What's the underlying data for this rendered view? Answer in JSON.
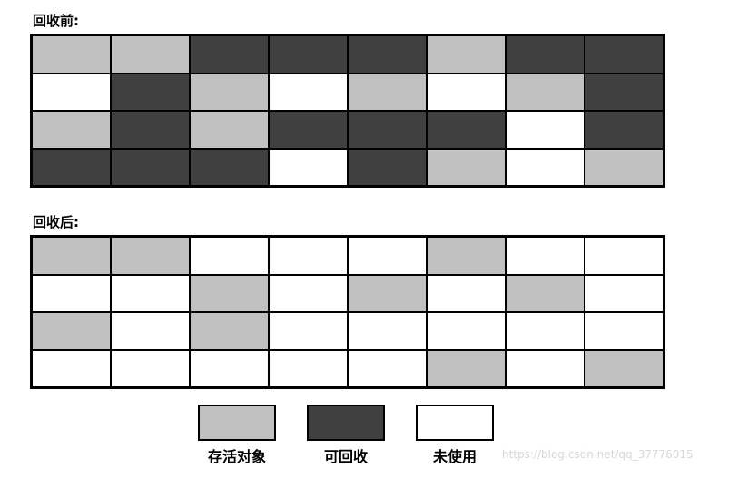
{
  "colors": {
    "live": "#c0c0c0",
    "reclaimable": "#404040",
    "unused": "#ffffff",
    "border": "#000000"
  },
  "before": {
    "title": "回收前:",
    "rows": [
      [
        "live",
        "live",
        "reclaimable",
        "reclaimable",
        "reclaimable",
        "live",
        "reclaimable",
        "reclaimable"
      ],
      [
        "unused",
        "reclaimable",
        "live",
        "unused",
        "live",
        "unused",
        "live",
        "reclaimable"
      ],
      [
        "live",
        "reclaimable",
        "live",
        "reclaimable",
        "reclaimable",
        "reclaimable",
        "unused",
        "reclaimable"
      ],
      [
        "reclaimable",
        "reclaimable",
        "reclaimable",
        "unused",
        "reclaimable",
        "live",
        "unused",
        "live"
      ]
    ]
  },
  "after": {
    "title": "回收后:",
    "rows": [
      [
        "live",
        "live",
        "unused",
        "unused",
        "unused",
        "live",
        "unused",
        "unused"
      ],
      [
        "unused",
        "unused",
        "live",
        "unused",
        "live",
        "unused",
        "live",
        "unused"
      ],
      [
        "live",
        "unused",
        "live",
        "unused",
        "unused",
        "unused",
        "unused",
        "unused"
      ],
      [
        "unused",
        "unused",
        "unused",
        "unused",
        "unused",
        "live",
        "unused",
        "live"
      ]
    ]
  },
  "legend": [
    {
      "key": "live",
      "label": "存活对象"
    },
    {
      "key": "reclaimable",
      "label": "可回收"
    },
    {
      "key": "unused",
      "label": "未使用"
    }
  ],
  "watermark": "https://blog.csdn.net/qq_37776015"
}
